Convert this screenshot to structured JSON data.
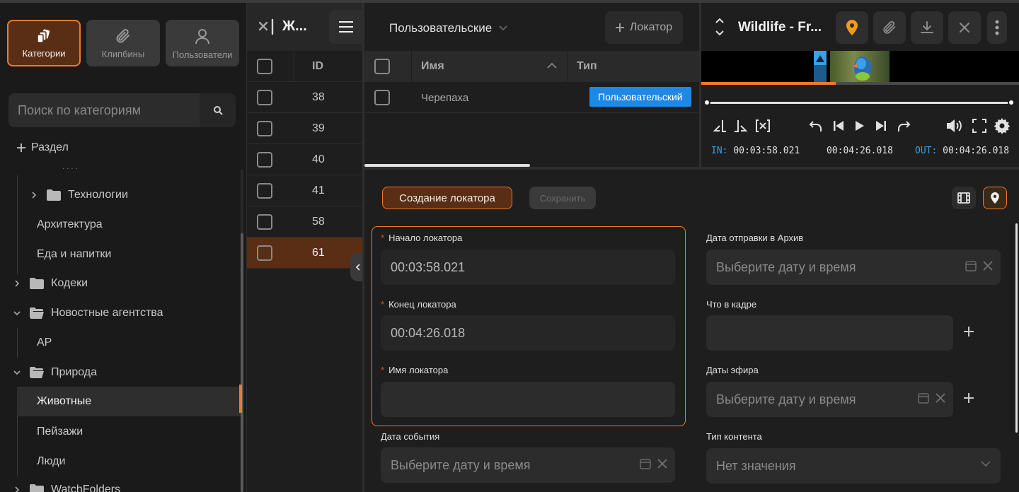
{
  "sidebar": {
    "modes": [
      {
        "label": "Категории",
        "icon": "categories-icon"
      },
      {
        "label": "Клипбины",
        "icon": "paperclip-icon"
      },
      {
        "label": "Пользователи",
        "icon": "user-icon"
      }
    ],
    "search_placeholder": "Поиск по категориям",
    "add_section": "Раздел",
    "tree": {
      "partial": "· · · ·",
      "technologies": "Технологии",
      "architecture": "Архитектура",
      "food": "Еда и напитки",
      "codecs": "Кодеки",
      "news": "Новостные агентства",
      "ap": "AP",
      "nature": "Природа",
      "animals": "Животные",
      "landscapes": "Пейзажи",
      "people": "Люди",
      "watchfolders": "WatchFolders"
    }
  },
  "idlist": {
    "title": "Ж...",
    "column": "ID",
    "rows": [
      "38",
      "39",
      "40",
      "41",
      "58",
      "61"
    ]
  },
  "locators": {
    "filter": "Пользовательские",
    "add_label": "Локатор",
    "col_name": "Имя",
    "col_type": "Тип",
    "row_name": "Черепаха",
    "row_type": "Пользовательский"
  },
  "player": {
    "title": "Wildlife - Fr...",
    "in_label": "IN:",
    "in_value": "00:03:58.021",
    "mid_value": "00:04:26.018",
    "out_label": "OUT:",
    "out_value": "00:04:26.018",
    "accent": "#ef9a1e"
  },
  "form": {
    "tab_create": "Создание локатора",
    "tab_save": "Сохранить",
    "start_label": "Начало локатора",
    "start_value": "00:03:58.021",
    "end_label": "Конец локатора",
    "end_value": "00:04:26.018",
    "name_label": "Имя локатора",
    "name_value": "",
    "event_date_label": "Дата события",
    "event_date_placeholder": "Выберите дату и время",
    "archive_label": "Дата отправки в Архив",
    "archive_placeholder": "Выберите дату и время",
    "inframe_label": "Что в кадре",
    "air_label": "Даты эфира",
    "air_placeholder": "Выберите дату и время",
    "content_type_label": "Тип контента",
    "content_type_value": "Нет значения"
  },
  "colors": {
    "accent": "#ef7a2e",
    "selected_bg": "#5a2e14",
    "tag_blue": "#1e88e5"
  }
}
